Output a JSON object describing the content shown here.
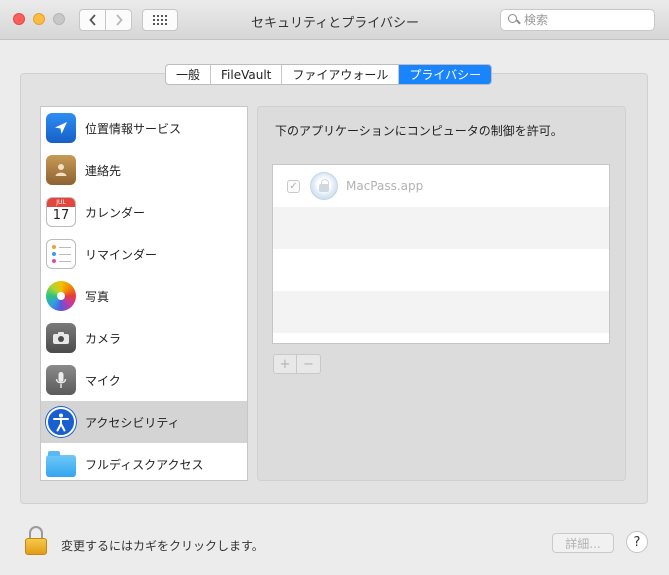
{
  "window": {
    "title": "セキュリティとプライバシー",
    "search_placeholder": "検索",
    "traffic_lights": [
      "close",
      "minimize",
      "maximize"
    ],
    "nav": {
      "back_icon": "chevron-left-icon",
      "forward_icon": "chevron-right-icon",
      "grid_icon": "grid-icon"
    }
  },
  "tabs": [
    {
      "label": "一般",
      "active": false
    },
    {
      "label": "FileVault",
      "active": false
    },
    {
      "label": "ファイアウォール",
      "active": false
    },
    {
      "label": "プライバシー",
      "active": true
    }
  ],
  "sidebar": {
    "items": [
      {
        "label": "位置情報サービス",
        "icon": "location-icon",
        "selected": false
      },
      {
        "label": "連絡先",
        "icon": "contacts-icon",
        "selected": false
      },
      {
        "label": "カレンダー",
        "icon": "calendar-icon",
        "selected": false,
        "calendar_month": "JUL",
        "calendar_day": "17"
      },
      {
        "label": "リマインダー",
        "icon": "reminders-icon",
        "selected": false
      },
      {
        "label": "写真",
        "icon": "photos-icon",
        "selected": false
      },
      {
        "label": "カメラ",
        "icon": "camera-icon",
        "selected": false
      },
      {
        "label": "マイク",
        "icon": "microphone-icon",
        "selected": false
      },
      {
        "label": "アクセシビリティ",
        "icon": "accessibility-icon",
        "selected": true
      },
      {
        "label": "フルディスクアクセス",
        "icon": "folder-icon",
        "selected": false
      }
    ]
  },
  "panel": {
    "description": "下のアプリケーションにコンピュータの制御を許可。",
    "apps": [
      {
        "name": "MacPass.app",
        "checked": true,
        "icon": "macpass-app-icon"
      }
    ],
    "add_label": "+",
    "remove_label": "−"
  },
  "footer": {
    "lock_text": "変更するにはカギをクリックします。",
    "details_label": "詳細...",
    "help_label": "?"
  },
  "colors": {
    "accent": "#1a84ff",
    "selection": "#d4d4d4"
  }
}
